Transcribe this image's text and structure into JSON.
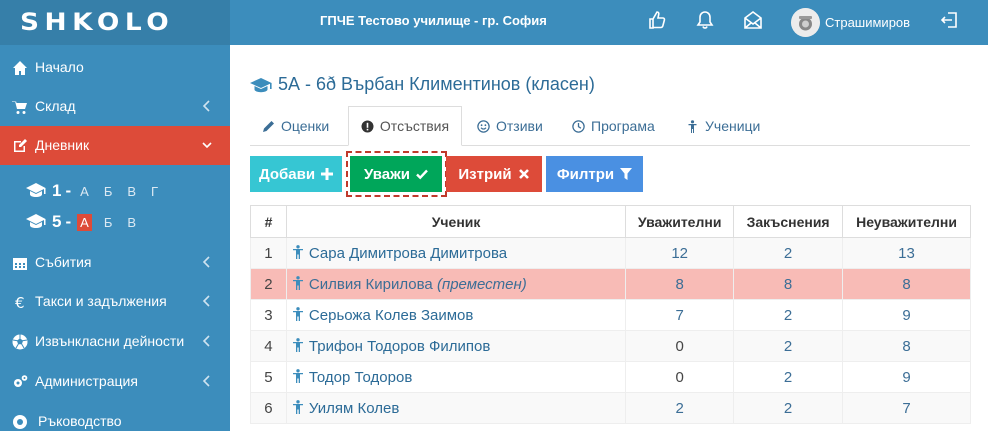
{
  "header": {
    "logo": "SHKOLO",
    "school": "ГПЧЕ Тестово училище - гр. София",
    "username": "Страшимиров"
  },
  "sidebar": {
    "items": [
      {
        "label": "Начало"
      },
      {
        "label": "Склад"
      },
      {
        "label": "Дневник"
      },
      {
        "label": "Събития"
      },
      {
        "label": "Такси и задължения"
      },
      {
        "label": "Извънкласни дейности"
      },
      {
        "label": "Администрация"
      },
      {
        "label": "Ръководство"
      }
    ],
    "grades": [
      {
        "num": "1",
        "letters": [
          "А",
          "Б",
          "В",
          "Г"
        ]
      },
      {
        "num": "5",
        "letters": [
          "А",
          "Б",
          "В"
        ]
      }
    ]
  },
  "main": {
    "title": "5А - 6ð Върбан Климентинов (класен)",
    "tabs": [
      "Оценки",
      "Отсъствия",
      "Отзиви",
      "Програма",
      "Ученици"
    ],
    "buttons": {
      "add": "Добави",
      "excuse": "Уважи",
      "delete": "Изтрий",
      "filter": "Филтри"
    },
    "table": {
      "headers": [
        "#",
        "Ученик",
        "Уважителни",
        "Закъснения",
        "Неуважителни"
      ],
      "rows": [
        {
          "n": "1",
          "name": "Сара Димитрова Димитрова",
          "note": "",
          "excused": "12",
          "late": "2",
          "unexcused": "13"
        },
        {
          "n": "2",
          "name": "Силвия Кирилова",
          "note": "(преместен)",
          "excused": "8",
          "late": "8",
          "unexcused": "8"
        },
        {
          "n": "3",
          "name": "Серьожа Колев Заимов",
          "note": "",
          "excused": "7",
          "late": "2",
          "unexcused": "9"
        },
        {
          "n": "4",
          "name": "Трифон Тодоров Филипов",
          "note": "",
          "excused": "0",
          "late": "2",
          "unexcused": "8"
        },
        {
          "n": "5",
          "name": "Тодор Тодоров",
          "note": "",
          "excused": "0",
          "late": "2",
          "unexcused": "9"
        },
        {
          "n": "6",
          "name": "Уилям Колев",
          "note": "",
          "excused": "2",
          "late": "2",
          "unexcused": "7"
        }
      ]
    }
  }
}
